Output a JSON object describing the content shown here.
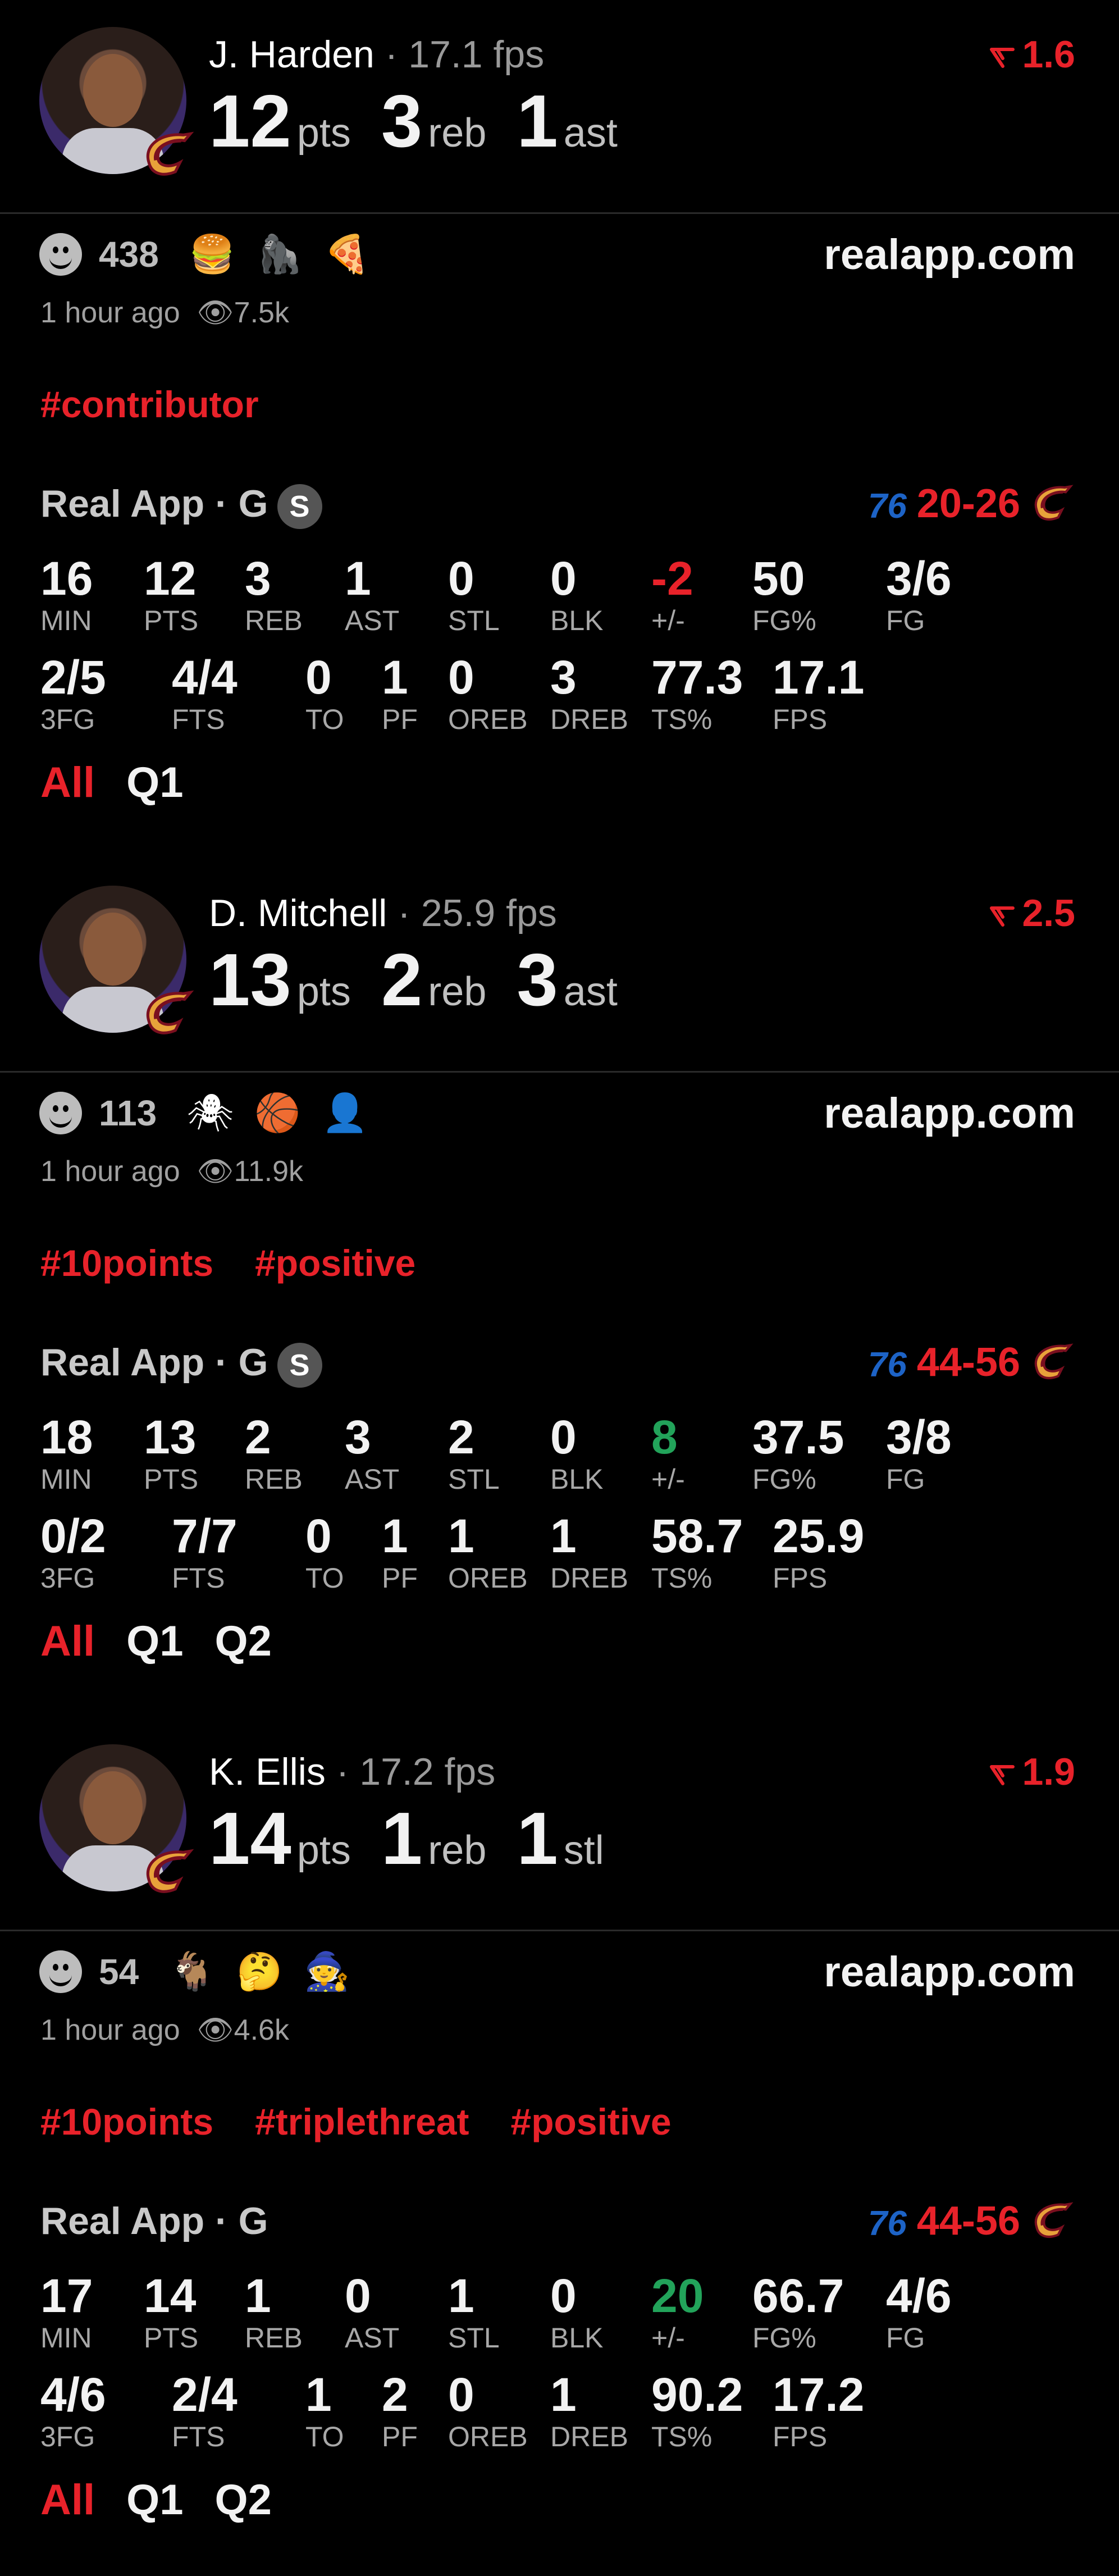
{
  "site": "realapp.com",
  "cards": [
    {
      "name": "J. Harden",
      "fps": "17.1 fps",
      "trend": "1.6",
      "s1": "12",
      "l1": "pts",
      "s2": "3",
      "l2": "reb",
      "s3": "1",
      "l3": "ast",
      "reactions": "438",
      "emojis": [
        "🍔",
        "🦍",
        "🍕"
      ],
      "time": "1 hour ago",
      "views": "7.5k",
      "tags": [
        "#contributor"
      ],
      "source": "Real App · G",
      "sbadge": "S",
      "score": "20-26",
      "stats": [
        {
          "v": "16",
          "l": "MIN"
        },
        {
          "v": "12",
          "l": "PTS"
        },
        {
          "v": "3",
          "l": "REB"
        },
        {
          "v": "1",
          "l": "AST"
        },
        {
          "v": "0",
          "l": "STL"
        },
        {
          "v": "0",
          "l": "BLK"
        },
        {
          "v": "-2",
          "l": "+/-"
        },
        {
          "v": "50",
          "l": "FG%"
        },
        {
          "v": "3/6",
          "l": "FG"
        },
        {
          "v": "2/5",
          "l": "3FG"
        },
        {
          "v": "4/4",
          "l": "FTS"
        },
        {
          "v": "0",
          "l": "TO"
        },
        {
          "v": "1",
          "l": "PF"
        },
        {
          "v": "0",
          "l": "OREB"
        },
        {
          "v": "3",
          "l": "DREB"
        },
        {
          "v": "77.3",
          "l": "TS%"
        },
        {
          "v": "17.1",
          "l": "FPS"
        }
      ],
      "quarters": [
        "All",
        "Q1"
      ]
    },
    {
      "name": "D. Mitchell",
      "fps": "25.9 fps",
      "trend": "2.5",
      "s1": "13",
      "l1": "pts",
      "s2": "2",
      "l2": "reb",
      "s3": "3",
      "l3": "ast",
      "reactions": "113",
      "emojis": [
        "🕷",
        "🏀",
        "👤"
      ],
      "time": "1 hour ago",
      "views": "11.9k",
      "tags": [
        "#10points",
        "#positive"
      ],
      "source": "Real App · G",
      "sbadge": "S",
      "score": "44-56",
      "stats": [
        {
          "v": "18",
          "l": "MIN"
        },
        {
          "v": "13",
          "l": "PTS"
        },
        {
          "v": "2",
          "l": "REB"
        },
        {
          "v": "3",
          "l": "AST"
        },
        {
          "v": "2",
          "l": "STL"
        },
        {
          "v": "0",
          "l": "BLK"
        },
        {
          "v": "8",
          "l": "+/-"
        },
        {
          "v": "37.5",
          "l": "FG%"
        },
        {
          "v": "3/8",
          "l": "FG"
        },
        {
          "v": "0/2",
          "l": "3FG"
        },
        {
          "v": "7/7",
          "l": "FTS"
        },
        {
          "v": "0",
          "l": "TO"
        },
        {
          "v": "1",
          "l": "PF"
        },
        {
          "v": "1",
          "l": "OREB"
        },
        {
          "v": "1",
          "l": "DREB"
        },
        {
          "v": "58.7",
          "l": "TS%"
        },
        {
          "v": "25.9",
          "l": "FPS"
        }
      ],
      "quarters": [
        "All",
        "Q1",
        "Q2"
      ]
    },
    {
      "name": "K. Ellis",
      "fps": "17.2 fps",
      "trend": "1.9",
      "s1": "14",
      "l1": "pts",
      "s2": "1",
      "l2": "reb",
      "s3": "1",
      "l3": "stl",
      "reactions": "54",
      "emojis": [
        "🐐",
        "🤔",
        "🧙"
      ],
      "time": "1 hour ago",
      "views": "4.6k",
      "tags": [
        "#10points",
        "#triplethreat",
        "#positive"
      ],
      "source": "Real App · G",
      "sbadge": "",
      "score": "44-56",
      "stats": [
        {
          "v": "17",
          "l": "MIN"
        },
        {
          "v": "14",
          "l": "PTS"
        },
        {
          "v": "1",
          "l": "REB"
        },
        {
          "v": "0",
          "l": "AST"
        },
        {
          "v": "1",
          "l": "STL"
        },
        {
          "v": "0",
          "l": "BLK"
        },
        {
          "v": "20",
          "l": "+/-"
        },
        {
          "v": "66.7",
          "l": "FG%"
        },
        {
          "v": "4/6",
          "l": "FG"
        },
        {
          "v": "4/6",
          "l": "3FG"
        },
        {
          "v": "2/4",
          "l": "FTS"
        },
        {
          "v": "1",
          "l": "TO"
        },
        {
          "v": "2",
          "l": "PF"
        },
        {
          "v": "0",
          "l": "OREB"
        },
        {
          "v": "1",
          "l": "DREB"
        },
        {
          "v": "90.2",
          "l": "TS%"
        },
        {
          "v": "17.2",
          "l": "FPS"
        }
      ],
      "quarters": [
        "All",
        "Q1",
        "Q2"
      ]
    }
  ]
}
